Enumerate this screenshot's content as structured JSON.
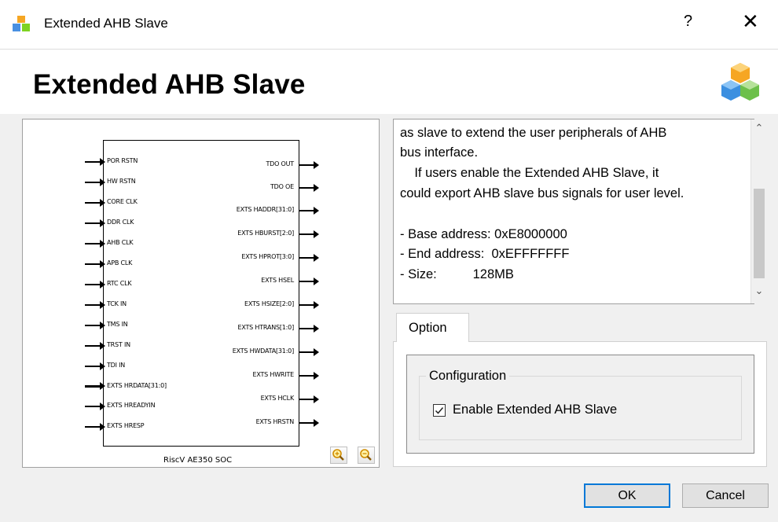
{
  "window": {
    "title": "Extended AHB Slave",
    "help_glyph": "?",
    "close_glyph": "✕"
  },
  "header": {
    "title": "Extended AHB Slave",
    "icon": "cubes-icon"
  },
  "diagram": {
    "block_label": "RiscV AE350 SOC",
    "inputs": [
      "POR RSTN",
      "HW RSTN",
      "CORE CLK",
      "DDR CLK",
      "AHB CLK",
      "APB CLK",
      "RTC CLK",
      "TCK IN",
      "TMS IN",
      "TRST IN",
      "TDI IN",
      "EXTS HRDATA[31:0]",
      "EXTS HREADYIN",
      "EXTS HRESP"
    ],
    "outputs": [
      "TDO OUT",
      "TDO OE",
      "EXTS HADDR[31:0]",
      "EXTS HBURST[2:0]",
      "EXTS HPROT[3:0]",
      "EXTS HSEL",
      "EXTS HSIZE[2:0]",
      "EXTS HTRANS[1:0]",
      "EXTS HWDATA[31:0]",
      "EXTS HWRITE",
      "EXTS HCLK",
      "EXTS HRSTN"
    ],
    "zoom_in_icon": "zoom-in-icon",
    "zoom_out_icon": "zoom-out-icon"
  },
  "description": {
    "lines": [
      "as slave to extend the user peripherals of AHB",
      "bus interface.",
      "    If users enable the Extended AHB Slave, it",
      "could export AHB slave bus signals for user level.",
      "",
      "- Base address: 0xE8000000",
      "- End address:  0xEFFFFFFF",
      "- Size:          128MB"
    ]
  },
  "options": {
    "tab_label": "Option",
    "group_label": "Configuration",
    "checkbox_label": "Enable Extended AHB Slave",
    "checkbox_checked": true
  },
  "buttons": {
    "ok": "OK",
    "cancel": "Cancel"
  },
  "colors": {
    "accent": "#0078d7"
  }
}
